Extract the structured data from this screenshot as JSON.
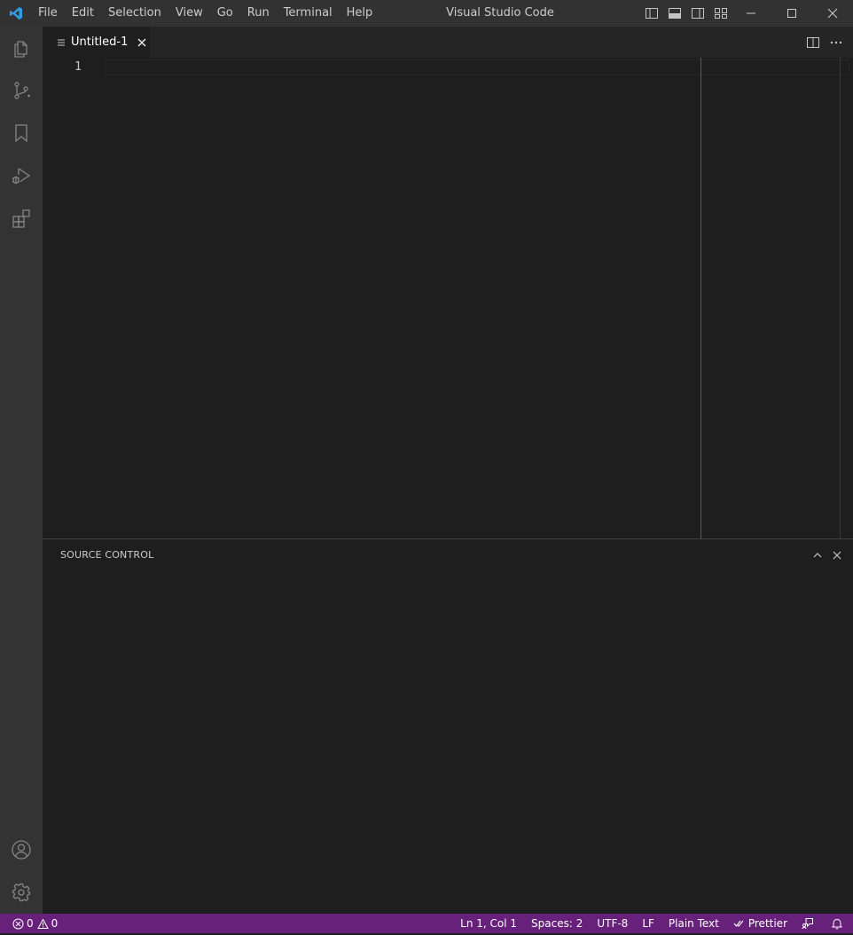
{
  "window": {
    "title": "Visual Studio Code"
  },
  "menu": {
    "items": [
      "File",
      "Edit",
      "Selection",
      "View",
      "Go",
      "Run",
      "Terminal",
      "Help"
    ]
  },
  "activitybar": {
    "top_icons": [
      "explorer-icon",
      "source-control-icon",
      "bookmark-icon",
      "run-debug-icon",
      "extensions-icon"
    ],
    "bottom_icons": [
      "accounts-icon",
      "manage-gear-icon"
    ]
  },
  "editor": {
    "tab_label": "Untitled-1",
    "line_numbers": [
      "1"
    ],
    "content": ""
  },
  "panel": {
    "title": "SOURCE CONTROL"
  },
  "statusbar": {
    "errors": "0",
    "warnings": "0",
    "position": "Ln 1, Col 1",
    "spaces": "Spaces: 2",
    "encoding": "UTF-8",
    "eol": "LF",
    "language": "Plain Text",
    "formatter": "Prettier"
  },
  "colors": {
    "statusbar_bg": "#68217a",
    "titlebar_bg": "#323233",
    "activitybar_bg": "#333333",
    "editor_bg": "#1e1e1e",
    "vscode_blue": "#007acc"
  }
}
